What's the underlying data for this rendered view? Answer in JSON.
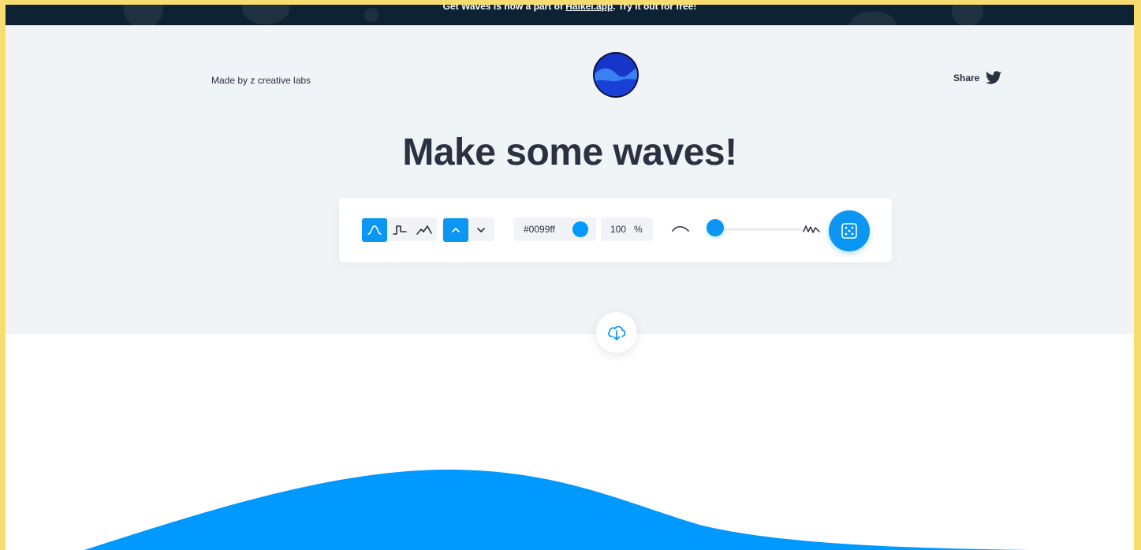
{
  "banner": {
    "text_prefix": "Get Waves is now a part of ",
    "link_text": "Haikei.app",
    "text_suffix": ". Try it out for free!"
  },
  "header": {
    "made_by": "Made by z creative labs",
    "share_label": "Share"
  },
  "hero": {
    "title": "Make some waves!"
  },
  "toolbar": {
    "wave_types": [
      "smooth-wave-icon",
      "step-wave-icon",
      "peak-wave-icon"
    ],
    "selected_wave_type": "smooth-wave-icon",
    "directions": [
      "chevron-up-icon",
      "chevron-down-icon"
    ],
    "selected_direction": "chevron-up-icon",
    "color_value": "#0099ff",
    "opacity_value": "100",
    "opacity_unit": "%",
    "complexity_level": 0.1
  },
  "colors": {
    "accent": "#0a96f2",
    "wave": "#0099ff",
    "banner_bg": "#0d2233",
    "hero_bg": "#f1f4f7",
    "text": "#2a3140",
    "page_border": "#f7dc6f"
  }
}
